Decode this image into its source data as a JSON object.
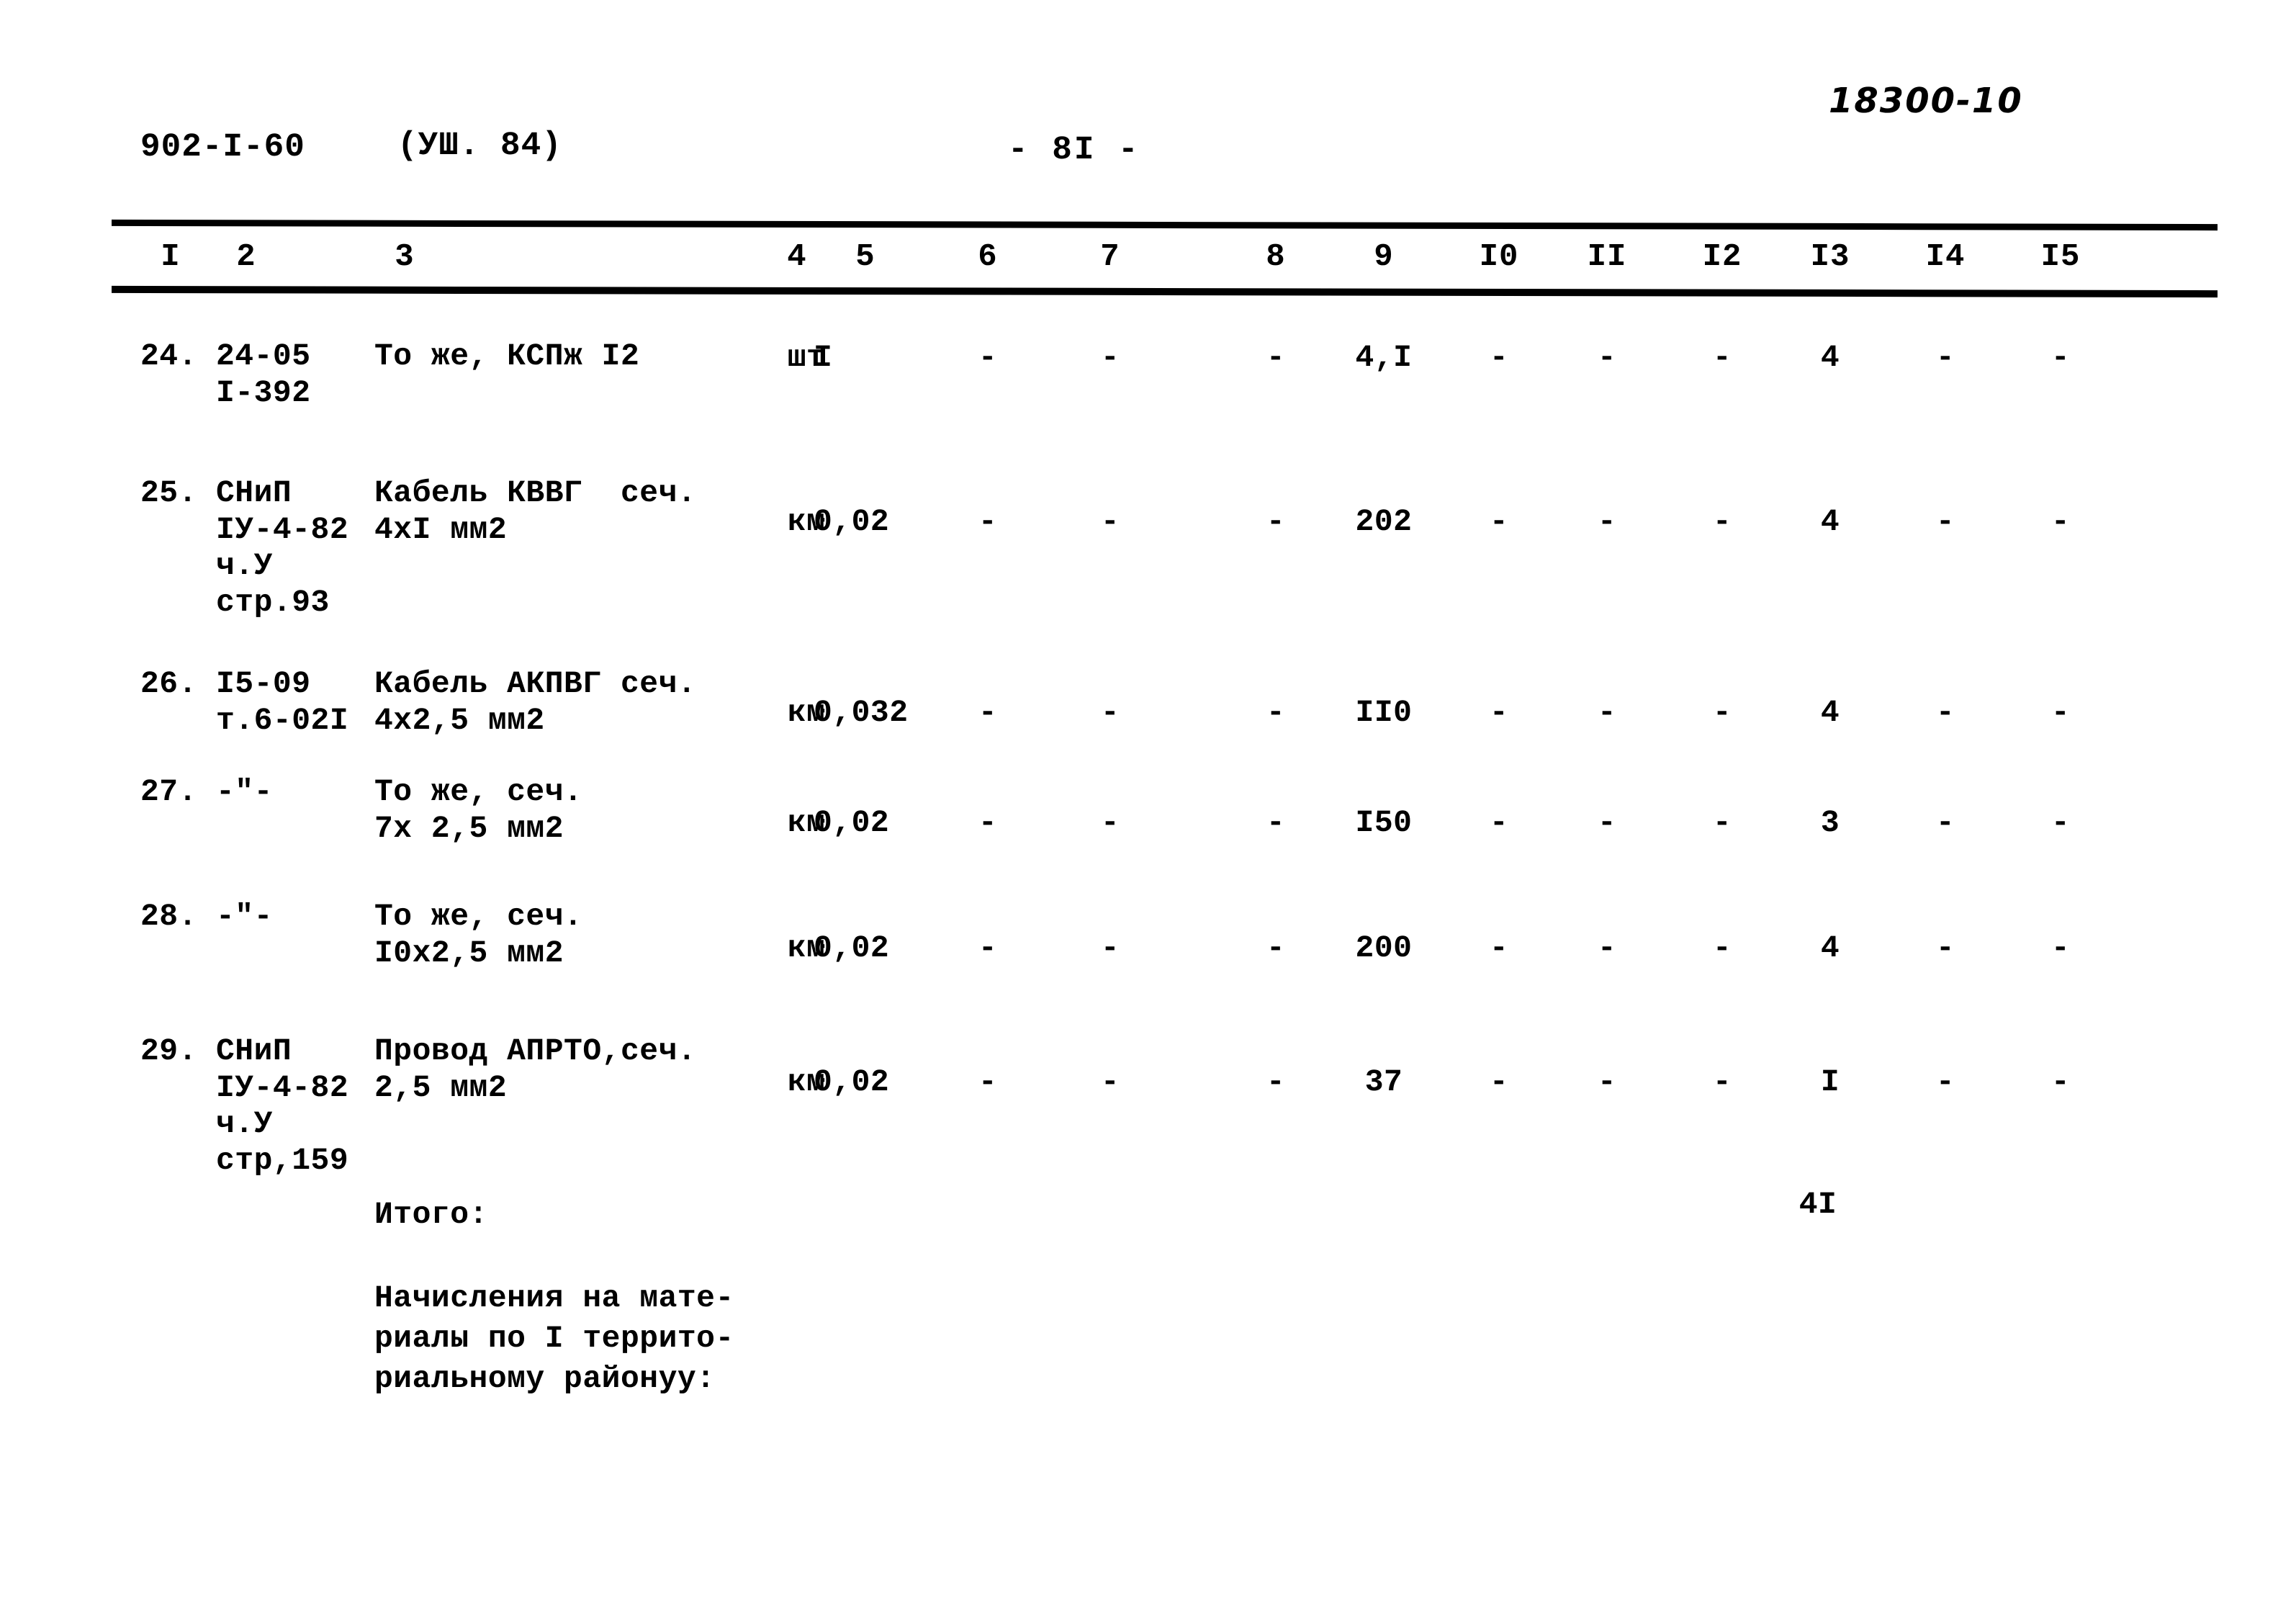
{
  "header": {
    "doc_code": "902-I-60",
    "doc_revision": "(УШ. 84)",
    "page_number": "- 8I -",
    "archive_note": "18300-10"
  },
  "table": {
    "column_headers": [
      "I",
      "2",
      "3",
      "4",
      "5",
      "6",
      "7",
      "8",
      "9",
      "I0",
      "II",
      "I2",
      "I3",
      "I4",
      "I5"
    ],
    "dash": "-",
    "rows": [
      {
        "no": "24.",
        "code": "24-05\nI-392",
        "name": "То же, КСПж I2",
        "unit": "шт",
        "c5": "I",
        "c6": "-",
        "c7": "-",
        "c8": "-",
        "c9": "4,I",
        "c10": "-",
        "c11": "-",
        "c12": "-",
        "c13": "4",
        "c14": "-",
        "c15": "-"
      },
      {
        "no": "25.",
        "code": "СНиП\nIУ-4-82\nч.У\nстр.93",
        "name": "Кабель КВВГ  сеч.\n4хI мм2",
        "unit": "км",
        "c5": "0,02",
        "c6": "-",
        "c7": "-",
        "c8": "-",
        "c9": "202",
        "c10": "-",
        "c11": "-",
        "c12": "-",
        "c13": "4",
        "c14": "-",
        "c15": "-"
      },
      {
        "no": "26.",
        "code": "I5-09\nт.6-02I",
        "name": "Кабель АКПВГ сеч.\n4х2,5 мм2",
        "unit": "км",
        "c5": "0,032",
        "c6": "-",
        "c7": "-",
        "c8": "-",
        "c9": "II0",
        "c10": "-",
        "c11": "-",
        "c12": "-",
        "c13": "4",
        "c14": "-",
        "c15": "-"
      },
      {
        "no": "27.",
        "code": "-\"-",
        "name": "То же, сеч.\n7х 2,5 мм2",
        "unit": "км",
        "c5": "0,02",
        "c6": "-",
        "c7": "-",
        "c8": "-",
        "c9": "I50",
        "c10": "-",
        "c11": "-",
        "c12": "-",
        "c13": "3",
        "c14": "-",
        "c15": "-"
      },
      {
        "no": "28.",
        "code": "-\"-",
        "name": "То же, сеч.\nI0х2,5 мм2",
        "unit": "км",
        "c5": "0,02",
        "c6": "-",
        "c7": "-",
        "c8": "-",
        "c9": "200",
        "c10": "-",
        "c11": "-",
        "c12": "-",
        "c13": "4",
        "c14": "-",
        "c15": "-"
      },
      {
        "no": "29.",
        "code": "СНиП\nIУ-4-82\nч.У\nстр,159",
        "name": "Провод АПРТО,сеч.\n2,5 мм2",
        "unit": "км",
        "c5": "0,02",
        "c6": "-",
        "c7": "-",
        "c8": "-",
        "c9": "37",
        "c10": "-",
        "c11": "-",
        "c12": "-",
        "c13": "I",
        "c14": "-",
        "c15": "-"
      }
    ],
    "total": {
      "label": "Итого:",
      "value": "4I"
    },
    "footnote": "Начисления на мате-\nриалы по I террито-\nриальному районуу:"
  }
}
